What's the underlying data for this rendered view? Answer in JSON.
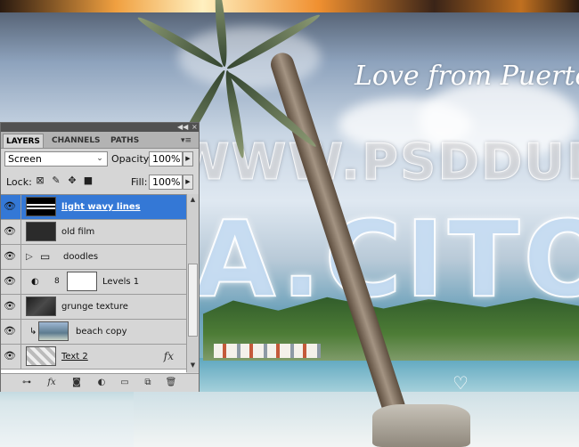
{
  "canvas": {
    "love_text": "Love from Puerto Ri",
    "watermark": "WWW.PSDDUDE.COM",
    "title_fragment": "A.CITO"
  },
  "panel": {
    "tabs": [
      {
        "label": "LAYERS",
        "active": true
      },
      {
        "label": "CHANNELS",
        "active": false
      },
      {
        "label": "PATHS",
        "active": false
      }
    ],
    "blend_mode": "Screen",
    "opacity_label": "Opacity:",
    "opacity_value": "100%",
    "lock_label": "Lock:",
    "fill_label": "Fill:",
    "fill_value": "100%",
    "layers": [
      {
        "name": "light wavy lines",
        "selected": true,
        "thumb": "light-lines"
      },
      {
        "name": "old film",
        "selected": false,
        "thumb": "dark-texture"
      },
      {
        "name": "doodles",
        "selected": false,
        "type": "group"
      },
      {
        "name": "Levels 1",
        "selected": false,
        "type": "adjustment"
      },
      {
        "name": "grunge texture",
        "selected": false,
        "thumb": "dark-texture"
      },
      {
        "name": "beach copy",
        "selected": false,
        "thumb": "beach",
        "clipped": true
      },
      {
        "name": "Text 2",
        "selected": false,
        "thumb": "text",
        "fx": "fx"
      }
    ],
    "bottom_icons": [
      "link-icon",
      "fx-icon",
      "mask-icon",
      "adjustment-icon",
      "folder-icon",
      "new-layer-icon",
      "trash-icon"
    ]
  }
}
